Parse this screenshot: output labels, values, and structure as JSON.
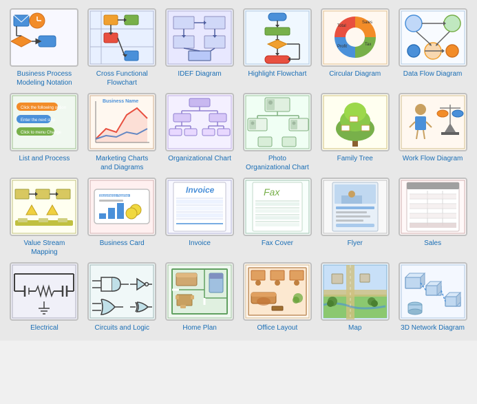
{
  "items": [
    {
      "id": "business-process",
      "label": "Business Process\nModeling Notation",
      "thumbClass": "bp-thumb",
      "color1": "#f28c28",
      "color2": "#4a90d9"
    },
    {
      "id": "cross-functional",
      "label": "Cross Functional\nFlowchart",
      "thumbClass": "cf-thumb",
      "color1": "#e8a040",
      "color2": "#78b04a"
    },
    {
      "id": "idef-diagram",
      "label": "IDEF Diagram",
      "thumbClass": "idef-thumb",
      "color1": "#7b68ee",
      "color2": "#9b88fe"
    },
    {
      "id": "highlight-flowchart",
      "label": "Highlight Flowchart",
      "thumbClass": "hf-thumb",
      "color1": "#4a90d9",
      "color2": "#a0c8f0"
    },
    {
      "id": "circular-diagram",
      "label": "Circular Diagram",
      "thumbClass": "circ-thumb",
      "color1": "#e8a040",
      "color2": "#78b04a"
    },
    {
      "id": "data-flow-diagram",
      "label": "Data Flow Diagram",
      "thumbClass": "df-thumb",
      "color1": "#4a90d9",
      "color2": "#f28c28"
    },
    {
      "id": "list-and-process",
      "label": "List and Process",
      "thumbClass": "lp-thumb",
      "color1": "#f28c28",
      "color2": "#4a90d9"
    },
    {
      "id": "marketing-charts",
      "label": "Marketing Charts\nand Diagrams",
      "thumbClass": "mc-thumb",
      "color1": "#e85040",
      "color2": "#f0a030"
    },
    {
      "id": "organizational-chart",
      "label": "Organizational Chart",
      "thumbClass": "oc-thumb",
      "color1": "#9b88fe",
      "color2": "#7b68ee"
    },
    {
      "id": "photo-org-chart",
      "label": "Photo\nOrganizational Chart",
      "thumbClass": "poc-thumb",
      "color1": "#78b04a",
      "color2": "#4a90d9"
    },
    {
      "id": "family-tree",
      "label": "Family Tree",
      "thumbClass": "ft-thumb",
      "color1": "#c8a060",
      "color2": "#78b04a"
    },
    {
      "id": "work-flow-diagram",
      "label": "Work Flow Diagram",
      "thumbClass": "wf-thumb",
      "color1": "#4a90d9",
      "color2": "#f28c28"
    },
    {
      "id": "value-stream-mapping",
      "label": "Value Stream\nMapping",
      "thumbClass": "vsm-thumb",
      "color1": "#808040",
      "color2": "#d0c060"
    },
    {
      "id": "business-card",
      "label": "Business Card",
      "thumbClass": "bc-thumb",
      "color1": "#4a90d9",
      "color2": "#f0a030"
    },
    {
      "id": "invoice",
      "label": "Invoice",
      "thumbClass": "inv-thumb",
      "color1": "#4a90d9",
      "color2": "#e0e8ff"
    },
    {
      "id": "fax-cover",
      "label": "Fax Cover",
      "thumbClass": "fax-thumb",
      "color1": "#78b04a",
      "color2": "#c0e0b0"
    },
    {
      "id": "flyer",
      "label": "Flyer",
      "thumbClass": "fly-thumb",
      "color1": "#4a90d9",
      "color2": "#c0d8f0"
    },
    {
      "id": "sales",
      "label": "Sales",
      "thumbClass": "sales-thumb",
      "color1": "#808080",
      "color2": "#d0d0d0"
    },
    {
      "id": "electrical",
      "label": "Electrical",
      "thumbClass": "elec-thumb",
      "color1": "#404040",
      "color2": "#808080"
    },
    {
      "id": "circuits-and-logic",
      "label": "Circuits and Logic",
      "thumbClass": "cil-thumb",
      "color1": "#4a90d9",
      "color2": "#404040"
    },
    {
      "id": "home-plan",
      "label": "Home Plan",
      "thumbClass": "hp-thumb",
      "color1": "#78b04a",
      "color2": "#c0e0b0"
    },
    {
      "id": "office-layout",
      "label": "Office Layout",
      "thumbClass": "ol-thumb",
      "color1": "#f0a030",
      "color2": "#c08040"
    },
    {
      "id": "map",
      "label": "Map",
      "thumbClass": "map-thumb",
      "color1": "#78b04a",
      "color2": "#4a90d9"
    },
    {
      "id": "3d-network-diagram",
      "label": "3D Network Diagram",
      "thumbClass": "net-thumb",
      "color1": "#4a90d9",
      "color2": "#c0d8f0"
    }
  ]
}
